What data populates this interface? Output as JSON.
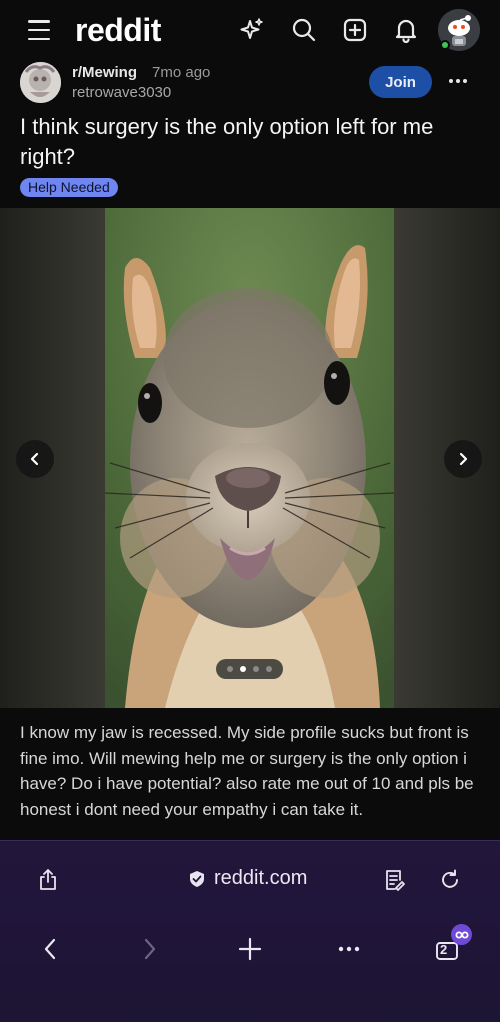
{
  "app": {
    "logo_text": "reddit"
  },
  "topbar": {
    "icons": [
      "menu-icon",
      "sparkle-icon",
      "search-icon",
      "create-post-icon",
      "notification-bell-icon",
      "user-avatar"
    ]
  },
  "post": {
    "subreddit": "r/Mewing",
    "time_ago": "7mo ago",
    "author": "retrowave3030",
    "join_label": "Join",
    "title": "I think surgery is the only option left for me right?",
    "flair": "Help Needed",
    "body": "I know my jaw is recessed. My side profile sucks but front is fine imo. Will mewing help me or surgery is the only option i have? Do i have potential? also rate me out of 10 and pls be honest i dont need your empathy i can take it.",
    "gallery": {
      "image_count": 4,
      "active_index": 1
    }
  },
  "browser": {
    "address": "reddit.com",
    "tab_count": "2",
    "colors": {
      "background": "#20153a",
      "badge": "#6f4ad6"
    }
  },
  "colors": {
    "join_button": "#1c4fa5",
    "flair": "#6f85f0",
    "online": "#3cc65a"
  }
}
